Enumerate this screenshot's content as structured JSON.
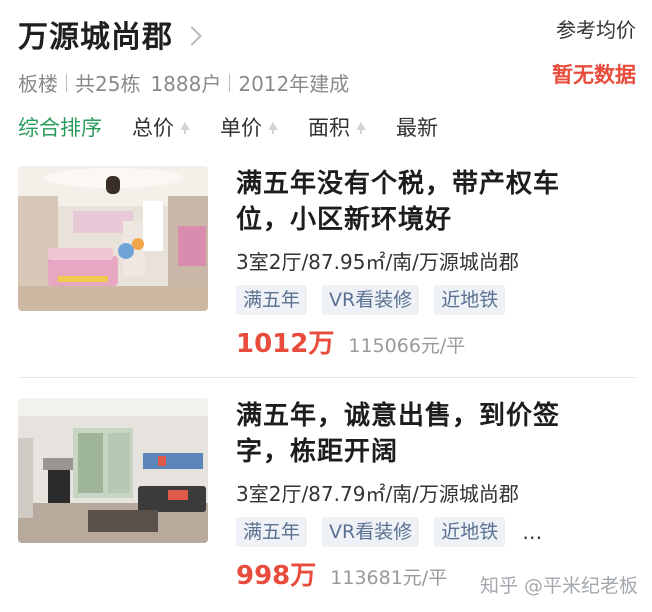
{
  "community": {
    "name": "万源城尚郡",
    "building_type": "板楼",
    "buildings": "共25栋",
    "households": "1888户",
    "built": "2012年建成"
  },
  "price_ref": {
    "label": "参考均价",
    "value": "暂无数据"
  },
  "sort": {
    "items": [
      {
        "label": "综合排序",
        "active": true
      },
      {
        "label": "总价",
        "arrow": "up-arrow"
      },
      {
        "label": "单价",
        "arrow": "up-arrow"
      },
      {
        "label": "面积",
        "arrow": "up-arrow"
      },
      {
        "label": "最新"
      }
    ]
  },
  "listings": [
    {
      "title_line1": "满五年没有个税，带产权车",
      "title_line2": "位，小区新环境好",
      "specs": "3室2厅/87.95㎡/南/万源城尚郡",
      "tags": [
        "满五年",
        "VR看装修",
        "近地铁"
      ],
      "total_price": "1012万",
      "unit_price": "115066元/平"
    },
    {
      "title_line1": "满五年，诚意出售，到价签",
      "title_line2": "字，栋距开阔",
      "specs": "3室2厅/87.79㎡/南/万源城尚郡",
      "tags": [
        "满五年",
        "VR看装修",
        "近地铁"
      ],
      "more": "…",
      "total_price": "998万",
      "unit_price": "113681元/平"
    }
  ],
  "watermark": "知乎 @平米纪老板",
  "colors": {
    "accent_green": "#2b9b5c",
    "price_red": "#e84c3d",
    "tag_bg": "#eef1f6",
    "tag_text": "#5b7191"
  }
}
